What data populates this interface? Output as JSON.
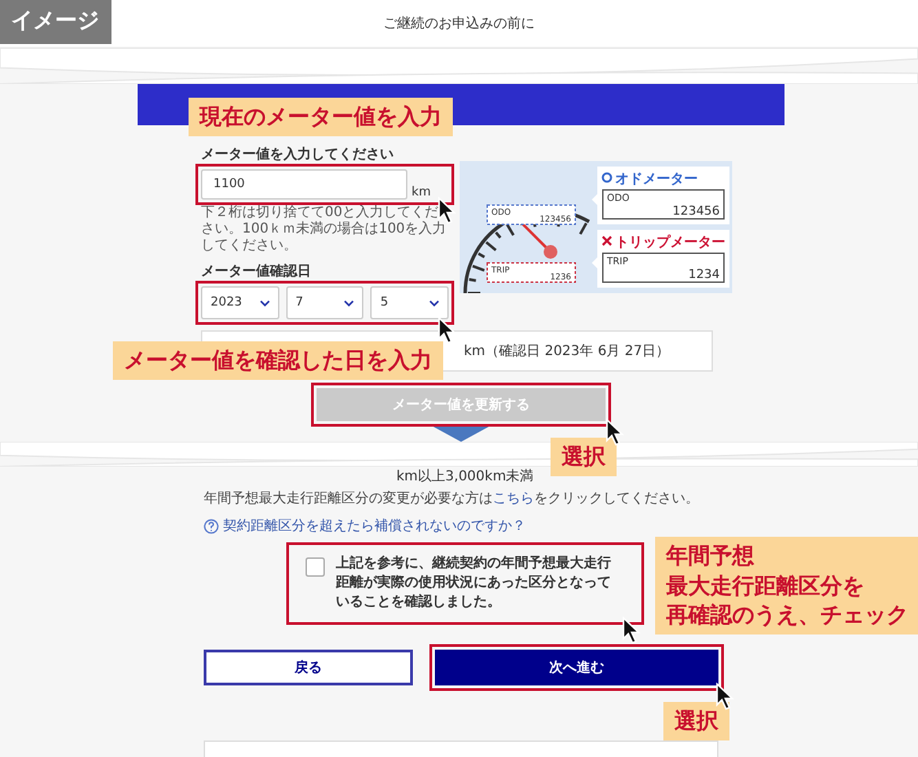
{
  "badge": {
    "label": "イメージ"
  },
  "header": {
    "title": "ご継続のお申込みの前に"
  },
  "meter_section": {
    "meter_field": {
      "label": "メーター値を入力してください",
      "value": "1100",
      "unit": "km",
      "hint": "下２桁は切り捨てて00と入力してください。100ｋｍ未満の場合は100を入力してください。",
      "callout": "現在のメーター値を入力"
    },
    "illustration": {
      "gauge_displays": [
        {
          "kind": "odo",
          "label": "ODO",
          "value": "123456"
        },
        {
          "kind": "trip",
          "label": "TRIP",
          "value": "1236"
        }
      ],
      "meters": [
        {
          "kind": "correct",
          "title": "オドメーター",
          "label": "ODO",
          "value": "123456"
        },
        {
          "kind": "wrong",
          "title": "トリップメーター",
          "label": "TRIP",
          "value": "1234"
        }
      ]
    },
    "date_field": {
      "label": "メーター値確認日",
      "selects": [
        "2023",
        "7",
        "5"
      ],
      "callout": "メーター値を確認した日を入力"
    },
    "summary": "km（確認日 2023年 6月 27日）",
    "update_button": {
      "label": "メーター値を更新する",
      "disabled": true,
      "callout": "選択"
    }
  },
  "distance_section": {
    "range_text": "km以上3,000km未満",
    "change_note": {
      "before": "年間予想最大走行距離区分の変更が必要な方は",
      "link": "こちら",
      "after": "をクリックしてください。"
    },
    "help_link": "契約距離区分を超えたら補償されないのですか？",
    "confirm": {
      "label": "上記を参考に、継続契約の年間予想最大走行距離が実際の使用状況にあった区分となっていることを確認しました。",
      "checked": false,
      "callout": [
        "年間予想",
        "最大走行距離区分を",
        "再確認のうえ、チェック"
      ]
    }
  },
  "buttons": [
    {
      "kind": "secondary",
      "label": "戻る"
    },
    {
      "kind": "primary",
      "label": "次へ進む",
      "callout": "選択"
    }
  ]
}
